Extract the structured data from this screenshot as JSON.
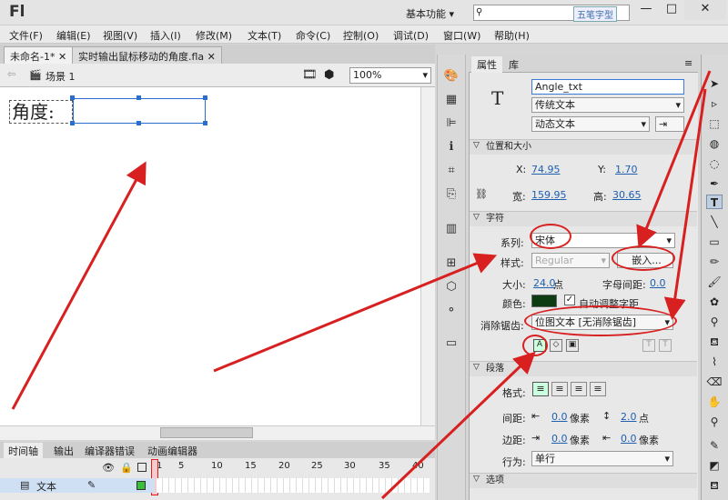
{
  "app": {
    "logo": "Fl",
    "workspace": "基本功能",
    "watermark": "五笔字型"
  },
  "window": {
    "minimize": "—",
    "maximize": "□",
    "close": "✕"
  },
  "menu": [
    "文件(F)",
    "编辑(E)",
    "视图(V)",
    "插入(I)",
    "修改(M)",
    "文本(T)",
    "命令(C)",
    "控制(O)",
    "调试(D)",
    "窗口(W)",
    "帮助(H)"
  ],
  "doc_tabs": [
    "未命名-1*",
    "实时输出鼠标移动的角度.fla"
  ],
  "scene": {
    "name": "场景 1",
    "zoom": "100%"
  },
  "stage": {
    "label": "角度:"
  },
  "timeline": {
    "tabs": [
      "时间轴",
      "输出",
      "编译器错误",
      "动画编辑器"
    ],
    "frame_numbers": [
      "1",
      "5",
      "10",
      "15",
      "20",
      "25",
      "30",
      "35",
      "40"
    ],
    "layer_name": "文本"
  },
  "properties": {
    "tabs": [
      "属性",
      "库"
    ],
    "instance_name": "Angle_txt",
    "text_engine": "传统文本",
    "text_type": "动态文本",
    "pos_section": "位置和大小",
    "x_label": "X:",
    "x_value": "74.95",
    "y_label": "Y:",
    "y_value": "1.70",
    "w_label": "宽:",
    "w_value": "159.95",
    "h_label": "高:",
    "h_value": "30.65",
    "char_section": "字符",
    "family_label": "系列:",
    "family_value": "宋体",
    "style_label": "样式:",
    "style_value": "Regular",
    "embed_button": "嵌入...",
    "size_label": "大小:",
    "size_value": "24.0",
    "size_unit": "点",
    "spacing_label": "字母间距:",
    "spacing_value": "0.0",
    "color_label": "颜色:",
    "autokern_label": "自动调整字距",
    "aa_label": "消除锯齿:",
    "aa_value": "位图文本 [无消除锯齿]",
    "para_section": "段落",
    "format_label": "格式:",
    "spacing2_label": "间距:",
    "indent_value": "0.0",
    "indent_unit": "像素",
    "line_value": "2.0",
    "line_unit": "点",
    "margin_label": "边距:",
    "margin_left": "0.0",
    "margin_right": "0.0",
    "margin_unit": "像素",
    "behavior_label": "行为:",
    "behavior_value": "单行",
    "options_section": "选项"
  },
  "colors": {
    "text_color": "#0d3b12",
    "accent": "#1f5fb0",
    "annotation": "#d82020"
  }
}
